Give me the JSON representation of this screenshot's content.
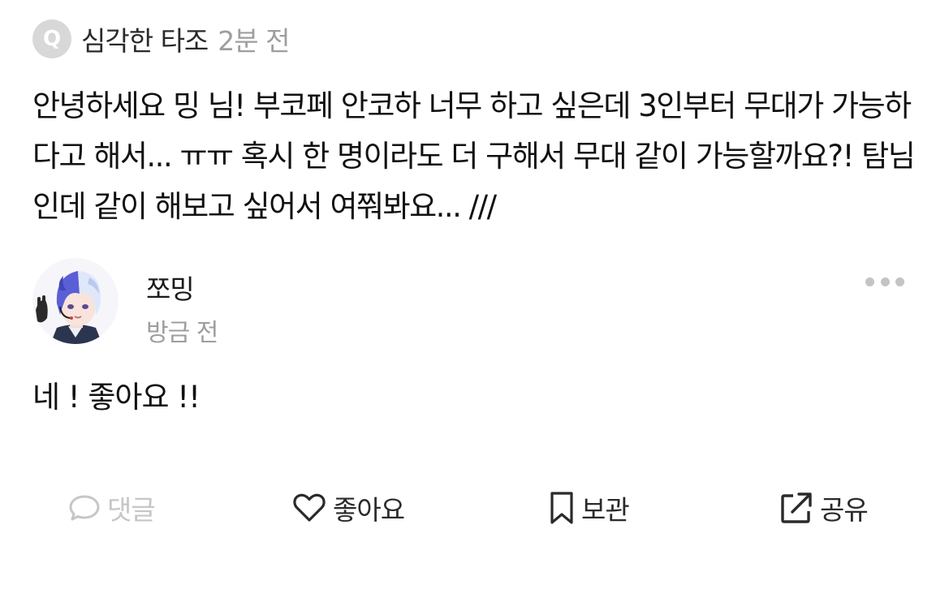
{
  "question": {
    "badge": "Q",
    "author": "심각한 타조",
    "time": "2분 전",
    "body": "안녕하세요 밍 님! 부코페 안코하 너무 하고 싶은데 3인부터 무대가 가능하다고 해서... ㅠㅠ 혹시 한 명이라도 더 구해서 무대 같이 가능할까요?! 탐님인데 같이 해보고 싶어서 여쭤봐요... ///"
  },
  "answer": {
    "author": "쪼밍",
    "time": "방금 전",
    "body": "네 ! 좋아요 !!",
    "avatar_icon": "avatar-illustration"
  },
  "actions": {
    "comment": {
      "label": "댓글",
      "icon": "speech-bubble-icon",
      "color": "#c6c6c6"
    },
    "like": {
      "label": "좋아요",
      "icon": "heart-icon"
    },
    "save": {
      "label": "보관",
      "icon": "bookmark-icon"
    },
    "share": {
      "label": "공유",
      "icon": "share-icon"
    }
  },
  "colors": {
    "badge_bg": "#d8d8d8",
    "muted_text": "#9e9e9e",
    "primary_text": "#111111"
  }
}
